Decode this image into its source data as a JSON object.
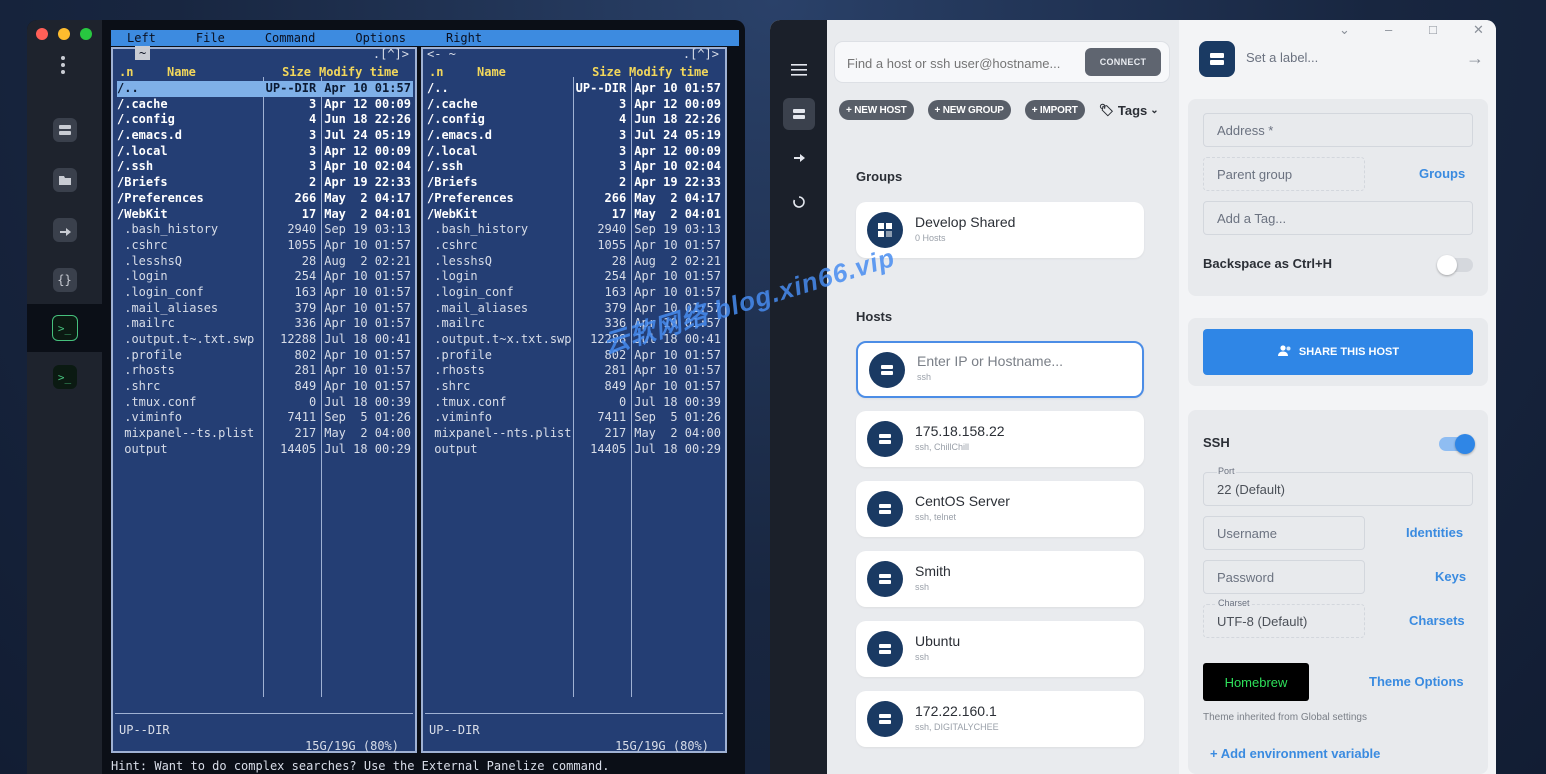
{
  "terminal": {
    "menu": [
      "Left",
      "File",
      "Command",
      "Options",
      "Right"
    ],
    "left_panel": {
      "path_top": "~",
      "indicator": ".[^]>",
      "headers": {
        "name_sort": ".n",
        "name": "Name",
        "size": "Size",
        "time": "Modify time"
      },
      "rows": [
        {
          "n": "/..",
          "s": "UP--DIR",
          "d": "Apr 10 01:57",
          "dir": true,
          "sel": true
        },
        {
          "n": "/.cache",
          "s": "3",
          "d": "Apr 12 00:09",
          "dir": true
        },
        {
          "n": "/.config",
          "s": "4",
          "d": "Jun 18 22:26",
          "dir": true
        },
        {
          "n": "/.emacs.d",
          "s": "3",
          "d": "Jul 24 05:19",
          "dir": true
        },
        {
          "n": "/.local",
          "s": "3",
          "d": "Apr 12 00:09",
          "dir": true
        },
        {
          "n": "/.ssh",
          "s": "3",
          "d": "Apr 10 02:04",
          "dir": true
        },
        {
          "n": "/Briefs",
          "s": "2",
          "d": "Apr 19 22:33",
          "dir": true
        },
        {
          "n": "/Preferences",
          "s": "266",
          "d": "May  2 04:17",
          "dir": true
        },
        {
          "n": "/WebKit",
          "s": "17",
          "d": "May  2 04:01",
          "dir": true
        },
        {
          "n": " .bash_history",
          "s": "2940",
          "d": "Sep 19 03:13"
        },
        {
          "n": " .cshrc",
          "s": "1055",
          "d": "Apr 10 01:57"
        },
        {
          "n": " .lesshsQ",
          "s": "28",
          "d": "Aug  2 02:21"
        },
        {
          "n": " .login",
          "s": "254",
          "d": "Apr 10 01:57"
        },
        {
          "n": " .login_conf",
          "s": "163",
          "d": "Apr 10 01:57"
        },
        {
          "n": " .mail_aliases",
          "s": "379",
          "d": "Apr 10 01:57"
        },
        {
          "n": " .mailrc",
          "s": "336",
          "d": "Apr 10 01:57"
        },
        {
          "n": " .output.t~.txt.swp",
          "s": "12288",
          "d": "Jul 18 00:41"
        },
        {
          "n": " .profile",
          "s": "802",
          "d": "Apr 10 01:57"
        },
        {
          "n": " .rhosts",
          "s": "281",
          "d": "Apr 10 01:57"
        },
        {
          "n": " .shrc",
          "s": "849",
          "d": "Apr 10 01:57"
        },
        {
          "n": " .tmux.conf",
          "s": "0",
          "d": "Jul 18 00:39"
        },
        {
          "n": " .viminfo",
          "s": "7411",
          "d": "Sep  5 01:26"
        },
        {
          "n": " mixpanel--ts.plist",
          "s": "217",
          "d": "May  2 04:00"
        },
        {
          "n": " output",
          "s": "14405",
          "d": "Jul 18 00:29"
        }
      ],
      "status": "UP--DIR",
      "free": "15G/19G (80%)"
    },
    "right_panel": {
      "path_top": "<- ~",
      "indicator": ".[^]>",
      "headers": {
        "name_sort": ".n",
        "name": "Name",
        "size": "Size",
        "time": "Modify time"
      },
      "rows": [
        {
          "n": "/..",
          "s": "UP--DIR",
          "d": "Apr 10 01:57",
          "dir": true
        },
        {
          "n": "/.cache",
          "s": "3",
          "d": "Apr 12 00:09",
          "dir": true
        },
        {
          "n": "/.config",
          "s": "4",
          "d": "Jun 18 22:26",
          "dir": true
        },
        {
          "n": "/.emacs.d",
          "s": "3",
          "d": "Jul 24 05:19",
          "dir": true
        },
        {
          "n": "/.local",
          "s": "3",
          "d": "Apr 12 00:09",
          "dir": true
        },
        {
          "n": "/.ssh",
          "s": "3",
          "d": "Apr 10 02:04",
          "dir": true
        },
        {
          "n": "/Briefs",
          "s": "2",
          "d": "Apr 19 22:33",
          "dir": true
        },
        {
          "n": "/Preferences",
          "s": "266",
          "d": "May  2 04:17",
          "dir": true
        },
        {
          "n": "/WebKit",
          "s": "17",
          "d": "May  2 04:01",
          "dir": true
        },
        {
          "n": " .bash_history",
          "s": "2940",
          "d": "Sep 19 03:13"
        },
        {
          "n": " .cshrc",
          "s": "1055",
          "d": "Apr 10 01:57"
        },
        {
          "n": " .lesshsQ",
          "s": "28",
          "d": "Aug  2 02:21"
        },
        {
          "n": " .login",
          "s": "254",
          "d": "Apr 10 01:57"
        },
        {
          "n": " .login_conf",
          "s": "163",
          "d": "Apr 10 01:57"
        },
        {
          "n": " .mail_aliases",
          "s": "379",
          "d": "Apr 10 01:57"
        },
        {
          "n": " .mailrc",
          "s": "336",
          "d": "Apr 10 01:57"
        },
        {
          "n": " .output.t~x.txt.swp",
          "s": "12288",
          "d": "Jul 18 00:41"
        },
        {
          "n": " .profile",
          "s": "802",
          "d": "Apr 10 01:57"
        },
        {
          "n": " .rhosts",
          "s": "281",
          "d": "Apr 10 01:57"
        },
        {
          "n": " .shrc",
          "s": "849",
          "d": "Apr 10 01:57"
        },
        {
          "n": " .tmux.conf",
          "s": "0",
          "d": "Jul 18 00:39"
        },
        {
          "n": " .viminfo",
          "s": "7411",
          "d": "Sep  5 01:26"
        },
        {
          "n": " mixpanel--nts.plist",
          "s": "217",
          "d": "May  2 04:00"
        },
        {
          "n": " output",
          "s": "14405",
          "d": "Jul 18 00:29"
        }
      ],
      "status": "UP--DIR",
      "free": "15G/19G (80%)"
    },
    "hint": "Hint: Want to do complex searches? Use the External Panelize command."
  },
  "hosts": {
    "search_placeholder": "Find a host or ssh user@hostname...",
    "connect_label": "CONNECT",
    "new_host": "+ NEW HOST",
    "new_group": "+ NEW GROUP",
    "import": "+ IMPORT",
    "tags": "Tags",
    "groups_title": "Groups",
    "groups": [
      {
        "name": "Develop Shared",
        "sub": "0 Hosts"
      }
    ],
    "hosts_title": "Hosts",
    "new_host_placeholder": {
      "name": "Enter IP or Hostname...",
      "sub": "ssh"
    },
    "list": [
      {
        "name": "175.18.158.22",
        "sub": "ssh, ChillChill"
      },
      {
        "name": "CentOS Server",
        "sub": "ssh, telnet"
      },
      {
        "name": "Smith",
        "sub": "ssh"
      },
      {
        "name": "Ubuntu",
        "sub": "ssh"
      },
      {
        "name": "172.22.160.1",
        "sub": "ssh, DIGITALYCHEE"
      }
    ]
  },
  "details": {
    "label_placeholder": "Set a label...",
    "address": "Address *",
    "parent_group": "Parent group",
    "groups_link": "Groups",
    "add_tag": "Add a Tag...",
    "backspace": "Backspace as Ctrl+H",
    "share": "SHARE THIS HOST",
    "ssh": "SSH",
    "port_label": "Port",
    "port_value": "22 (Default)",
    "username": "Username",
    "identities": "Identities",
    "password": "Password",
    "keys": "Keys",
    "charset_label": "Charset",
    "charset_value": "UTF-8 (Default)",
    "charsets": "Charsets",
    "theme": "Homebrew",
    "theme_options": "Theme Options",
    "theme_note": "Theme inherited from Global settings",
    "add_env": "+ Add environment variable"
  },
  "watermark": "云软网络 blog.xin66.vip",
  "colors": {
    "accent": "#2f86e6",
    "mc_blue": "#243e74",
    "menubar": "#3d8be0",
    "dir_header": "#f2d75b"
  }
}
